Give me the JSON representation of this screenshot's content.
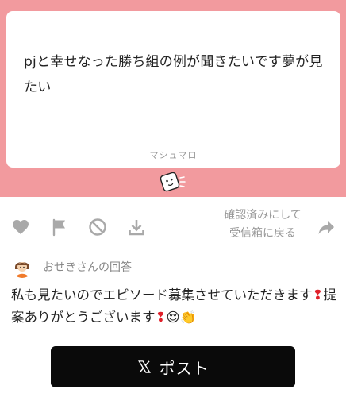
{
  "question": {
    "text": "pjと幸せなった勝ち組の例が聞きたいです夢が見たい",
    "footer": "マシュマロ"
  },
  "actions": {
    "like_icon": "heart-icon",
    "report_icon": "flag-icon",
    "block_icon": "block-icon",
    "download_icon": "download-icon",
    "confirm_line1": "確認済みにして",
    "confirm_line2": "受信箱に戻る",
    "forward_icon": "share-arrow-icon"
  },
  "answer": {
    "label": "おせきさんの回答",
    "part1": "私も見たいのでエピソード募集させていただきます",
    "bang1": "❢",
    "part2": "提案ありがとうございます",
    "bang2": "❢",
    "emoji": "😌👏"
  },
  "post_button": {
    "label": "ポスト",
    "icon": "x-logo-icon"
  },
  "colors": {
    "banner": "#f29a9e",
    "button": "#0a0a0a",
    "icon_gray": "#a9a9a9"
  }
}
